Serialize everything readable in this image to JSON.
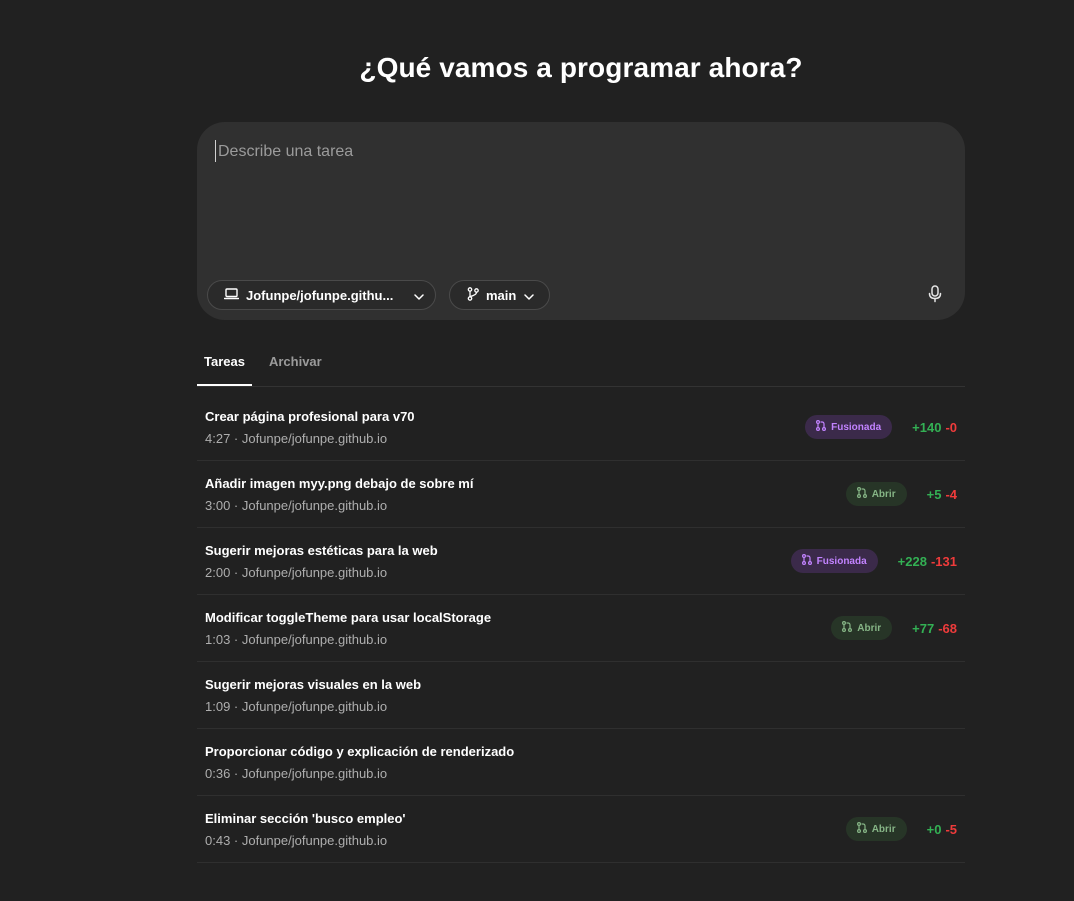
{
  "header": {
    "title": "¿Qué vamos a programar ahora?"
  },
  "composer": {
    "placeholder": "Describe una tarea",
    "repo_label": "Jofunpe/jofunpe.githu...",
    "branch_label": "main"
  },
  "tabs": [
    {
      "label": "Tareas",
      "active": true
    },
    {
      "label": "Archivar",
      "active": false
    }
  ],
  "tasks": [
    {
      "title": "Crear página profesional para v70",
      "meta": "4:27 · Jofunpe/jofunpe.github.io",
      "status": "Fusionada",
      "status_type": "merged",
      "additions": "+140",
      "deletions": "-0"
    },
    {
      "title": "Añadir imagen myy.png debajo de sobre mí",
      "meta": "3:00 · Jofunpe/jofunpe.github.io",
      "status": "Abrir",
      "status_type": "open",
      "additions": "+5",
      "deletions": "-4"
    },
    {
      "title": "Sugerir mejoras estéticas para la web",
      "meta": "2:00 · Jofunpe/jofunpe.github.io",
      "status": "Fusionada",
      "status_type": "merged",
      "additions": "+228",
      "deletions": "-131"
    },
    {
      "title": "Modificar toggleTheme para usar localStorage",
      "meta": "1:03 · Jofunpe/jofunpe.github.io",
      "status": "Abrir",
      "status_type": "open",
      "additions": "+77",
      "deletions": "-68"
    },
    {
      "title": "Sugerir mejoras visuales en la web",
      "meta": "1:09 · Jofunpe/jofunpe.github.io"
    },
    {
      "title": "Proporcionar código y explicación de renderizado",
      "meta": "0:36 · Jofunpe/jofunpe.github.io"
    },
    {
      "title": "Eliminar sección 'busco empleo'",
      "meta": "0:43 · Jofunpe/jofunpe.github.io",
      "status": "Abrir",
      "status_type": "open",
      "additions": "+0",
      "deletions": "-5"
    }
  ],
  "colors": {
    "background": "#212121",
    "composer": "#303030",
    "merged": "#c283ff",
    "open": "#86b586",
    "additions": "#33b054",
    "deletions": "#ef3b3b"
  },
  "icons": {
    "repo": "laptop-icon",
    "branch": "git-branch-icon",
    "dropdown": "chevron-down-icon",
    "mic": "microphone-icon",
    "pr": "pull-request-icon"
  }
}
